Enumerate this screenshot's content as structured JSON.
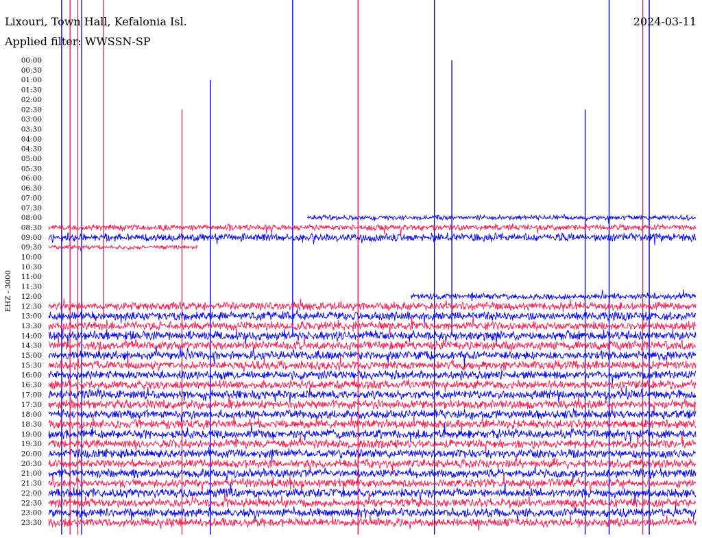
{
  "header": {
    "station": "Lixouri, Town Hall, Kefalonia Isl.",
    "date": "2024-03-11",
    "filter_label": "Applied filter: WWSSN-SP"
  },
  "channel_label": "EHZ - 3000",
  "colors": {
    "trace_a": "#0000ff",
    "trace_b": "#ff1a4d",
    "background": "#ffffff",
    "text": "#000000"
  },
  "chart_data": {
    "type": "line",
    "subtype": "helicorder",
    "title": "Lixouri, Town Hall, Kefalonia Isl.",
    "date": "2024-03-11",
    "filter": "WWSSN-SP",
    "channel": "EHZ - 3000",
    "row_labels": [
      "00:00",
      "00:30",
      "01:00",
      "01:30",
      "02:00",
      "02:30",
      "03:00",
      "03:30",
      "04:00",
      "04:30",
      "05:00",
      "05:30",
      "06:00",
      "06:30",
      "07:00",
      "07:30",
      "08:00",
      "08:30",
      "09:00",
      "09:30",
      "10:00",
      "10:30",
      "11:00",
      "11:30",
      "12:00",
      "12:30",
      "13:00",
      "13:30",
      "14:00",
      "14:30",
      "15:00",
      "15:30",
      "16:00",
      "16:30",
      "17:00",
      "17:30",
      "18:00",
      "18:30",
      "19:00",
      "19:30",
      "20:00",
      "20:30",
      "21:00",
      "21:30",
      "22:00",
      "22:30",
      "23:00",
      "23:30"
    ],
    "trace_color_order": [
      "trace_a",
      "trace_b"
    ],
    "traces": [
      {
        "start": "08:00",
        "x_start": 0.4,
        "x_end": 1.0,
        "level": 0.18
      },
      {
        "start": "08:30",
        "x_start": 0.0,
        "x_end": 1.0,
        "level": 0.22
      },
      {
        "start": "09:00",
        "x_start": 0.0,
        "x_end": 1.0,
        "level": 0.3
      },
      {
        "start": "09:30",
        "x_start": 0.0,
        "x_end": 0.23,
        "level": 0.16
      },
      {
        "start": "12:00",
        "x_start": 0.56,
        "x_end": 1.0,
        "level": 0.22
      },
      {
        "start": "12:30",
        "x_start": 0.0,
        "x_end": 1.0,
        "level": 0.3
      },
      {
        "start": "13:00",
        "x_start": 0.0,
        "x_end": 1.0,
        "level": 0.32
      },
      {
        "start": "13:30",
        "x_start": 0.0,
        "x_end": 1.0,
        "level": 0.32
      },
      {
        "start": "14:00",
        "x_start": 0.0,
        "x_end": 1.0,
        "level": 0.32
      },
      {
        "start": "14:30",
        "x_start": 0.0,
        "x_end": 1.0,
        "level": 0.32
      },
      {
        "start": "15:00",
        "x_start": 0.0,
        "x_end": 1.0,
        "level": 0.32
      },
      {
        "start": "15:30",
        "x_start": 0.0,
        "x_end": 1.0,
        "level": 0.32
      },
      {
        "start": "16:00",
        "x_start": 0.0,
        "x_end": 1.0,
        "level": 0.32
      },
      {
        "start": "16:30",
        "x_start": 0.0,
        "x_end": 1.0,
        "level": 0.32
      },
      {
        "start": "17:00",
        "x_start": 0.0,
        "x_end": 1.0,
        "level": 0.32
      },
      {
        "start": "17:30",
        "x_start": 0.0,
        "x_end": 1.0,
        "level": 0.32
      },
      {
        "start": "18:00",
        "x_start": 0.0,
        "x_end": 1.0,
        "level": 0.32
      },
      {
        "start": "18:30",
        "x_start": 0.0,
        "x_end": 1.0,
        "level": 0.32
      },
      {
        "start": "19:00",
        "x_start": 0.0,
        "x_end": 1.0,
        "level": 0.32
      },
      {
        "start": "19:30",
        "x_start": 0.0,
        "x_end": 1.0,
        "level": 0.32
      },
      {
        "start": "20:00",
        "x_start": 0.0,
        "x_end": 1.0,
        "level": 0.32
      },
      {
        "start": "20:30",
        "x_start": 0.0,
        "x_end": 1.0,
        "level": 0.32
      },
      {
        "start": "21:00",
        "x_start": 0.0,
        "x_end": 1.0,
        "level": 0.32
      },
      {
        "start": "21:30",
        "x_start": 0.0,
        "x_end": 1.0,
        "level": 0.32
      },
      {
        "start": "22:00",
        "x_start": 0.0,
        "x_end": 1.0,
        "level": 0.32
      },
      {
        "start": "22:30",
        "x_start": 0.0,
        "x_end": 1.0,
        "level": 0.32
      },
      {
        "start": "23:00",
        "x_start": 0.0,
        "x_end": 1.0,
        "level": 0.32
      },
      {
        "start": "23:30",
        "x_start": 0.0,
        "x_end": 1.0,
        "level": 0.32
      }
    ],
    "spikes": [
      {
        "x": 0.02,
        "row": "00:00",
        "to_row": "23:30",
        "trace": "trace_a"
      },
      {
        "x": 0.033,
        "row": "00:00",
        "to_row": "23:30",
        "trace": "trace_b"
      },
      {
        "x": 0.045,
        "row": "00:00",
        "to_row": "23:30",
        "trace": "trace_b"
      },
      {
        "x": 0.051,
        "row": "00:00",
        "to_row": "23:30",
        "trace": "trace_a"
      },
      {
        "x": 0.085,
        "row": "00:00",
        "to_row": "12:30",
        "trace": "trace_b"
      },
      {
        "x": 0.206,
        "row": "03:30",
        "to_row": "23:30",
        "trace": "trace_b"
      },
      {
        "x": 0.25,
        "row": "02:00",
        "to_row": "23:30",
        "trace": "trace_a"
      },
      {
        "x": 0.377,
        "row": "00:00",
        "to_row": "13:30",
        "trace": "trace_a"
      },
      {
        "x": 0.478,
        "row": "00:00",
        "to_row": "23:30",
        "trace": "trace_b"
      },
      {
        "x": 0.596,
        "row": "00:00",
        "to_row": "23:30",
        "trace": "trace_a"
      },
      {
        "x": 0.623,
        "row": "01:00",
        "to_row": "13:30",
        "trace": "trace_a"
      },
      {
        "x": 0.829,
        "row": "03:30",
        "to_row": "23:30",
        "trace": "trace_a"
      },
      {
        "x": 0.866,
        "row": "00:00",
        "to_row": "23:30",
        "trace": "trace_a"
      },
      {
        "x": 0.918,
        "row": "00:00",
        "to_row": "23:30",
        "trace": "trace_b"
      },
      {
        "x": 0.928,
        "row": "00:00",
        "to_row": "23:30",
        "trace": "trace_a"
      }
    ]
  }
}
